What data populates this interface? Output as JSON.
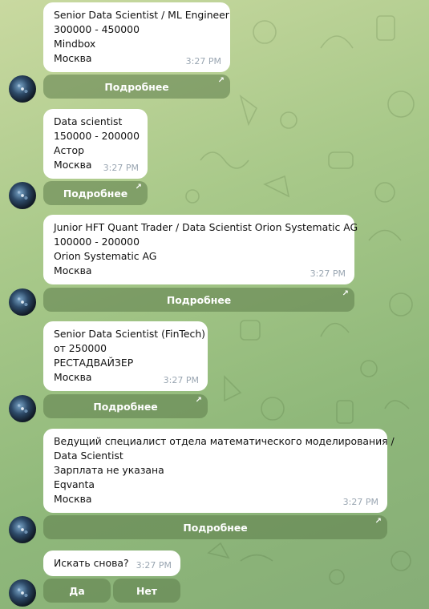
{
  "vacancies": [
    {
      "lines": [
        "Senior Data Scientist / ML Engineer",
        "300000 - 450000",
        "Mindbox",
        "Москва"
      ],
      "time": "3:27 PM",
      "button": "Подробнее"
    },
    {
      "lines": [
        "Data scientist",
        "150000 - 200000",
        "Астор",
        "Москва"
      ],
      "time": "3:27 PM",
      "button": "Подробнее"
    },
    {
      "lines": [
        "Junior HFT Quant Trader / Data Scientist Orion Systematic AG",
        "100000 - 200000",
        "Orion Systematic AG",
        "Москва"
      ],
      "time": "3:27 PM",
      "button": "Подробнее"
    },
    {
      "lines": [
        "Senior Data Scientist (FinTech)",
        "от 250000",
        "РЕСТАДВАЙЗЕР",
        "Москва"
      ],
      "time": "3:27 PM",
      "button": "Подробнее"
    },
    {
      "lines": [
        "Ведущий специалист отдела математического моделирования /",
        "Data Scientist",
        "Зарплата не указана",
        "Eqvanta",
        "Москва"
      ],
      "time": "3:27 PM",
      "button": "Подробнее"
    }
  ],
  "search_again": {
    "text": "Искать снова?",
    "time": "3:27 PM",
    "yes": "Да",
    "no": "Нет"
  },
  "icons": {
    "link": "arrow-up-right-icon",
    "avatar": "bot-avatar"
  },
  "colors": {
    "bubble": "#ffffff",
    "time": "#9aa6b2",
    "button_bg": "#5c7c4a"
  }
}
